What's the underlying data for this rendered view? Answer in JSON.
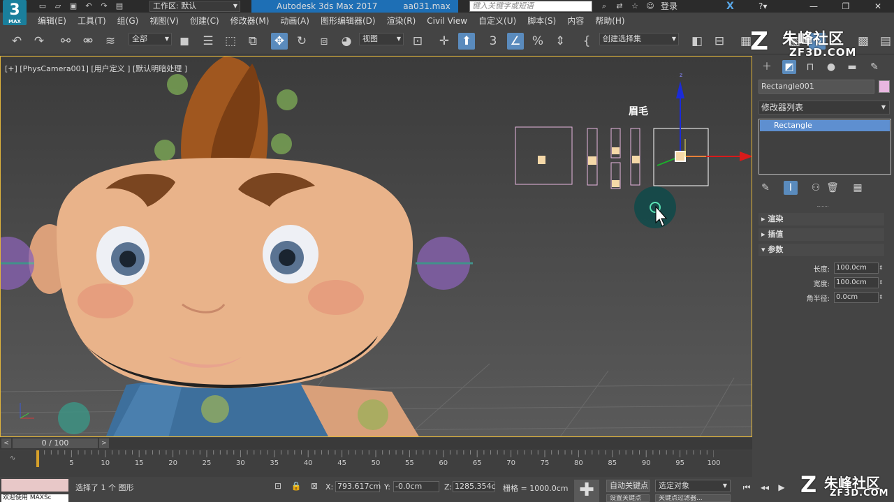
{
  "titlebar": {
    "app_logo": "3",
    "app_logo_sub": "MAX",
    "workspace_label": "工作区: 默认",
    "app_title": "Autodesk 3ds Max 2017",
    "file_name": "aa031.max",
    "search_placeholder": "键入关键字或短语",
    "login_label": "登录"
  },
  "menu": {
    "items": [
      "编辑(E)",
      "工具(T)",
      "组(G)",
      "视图(V)",
      "创建(C)",
      "修改器(M)",
      "动画(A)",
      "图形编辑器(D)",
      "渲染(R)",
      "Civil View",
      "自定义(U)",
      "脚本(S)",
      "内容",
      "帮助(H)"
    ]
  },
  "toolbar": {
    "selection_filter": "全部",
    "ref_coord": "视图",
    "named_selection": "创建选择集"
  },
  "viewport": {
    "label": "[+] [PhysCamera001] [用户定义 ] [默认明暗处理 ]",
    "shape_label": "眉毛",
    "gizmo_z_label": "z"
  },
  "command_panel": {
    "object_name": "Rectangle001",
    "object_color": "#e8b7e0",
    "modifier_list": "修改器列表",
    "stack_items": [
      "Rectangle"
    ],
    "rollouts": {
      "render": "渲染",
      "interpolation": "插值",
      "parameters": "参数"
    },
    "params": {
      "length_label": "长度:",
      "length_value": "100.0cm",
      "width_label": "宽度:",
      "width_value": "100.0cm",
      "corner_label": "角半径:",
      "corner_value": "0.0cm"
    }
  },
  "timeline": {
    "frame_display": "0 / 100",
    "ticks": [
      "5",
      "10",
      "15",
      "20",
      "25",
      "30",
      "35",
      "40",
      "45",
      "50",
      "55",
      "60",
      "65",
      "70",
      "75",
      "80",
      "85",
      "90",
      "95",
      "100"
    ]
  },
  "statusbar": {
    "maxscript_text": "欢迎使用 MAXSc",
    "status_text": "选择了 1 个 图形",
    "x_label": "X:",
    "x_value": "793.617cm",
    "y_label": "Y:",
    "y_value": "-0.0cm",
    "z_label": "Z:",
    "z_value": "1285.354c",
    "grid": "栅格 = 1000.0cm",
    "auto_key": "自动关键点",
    "selected_object": "选定对象",
    "set_key": "设置关键点",
    "key_filters": "关键点过滤器..."
  },
  "watermarks": {
    "top_brand": "朱峰社区",
    "top_url": "ZF3D.COM",
    "bottom_brand": "朱峰社区",
    "bottom_url": "ZF3D.COM"
  },
  "colors": {
    "accent": "#5a8bbd",
    "title_active": "#1e6fb5",
    "viewport_border": "#e0b43c",
    "shape_color": "#e8b7e0",
    "skin": "#e9b38a"
  }
}
